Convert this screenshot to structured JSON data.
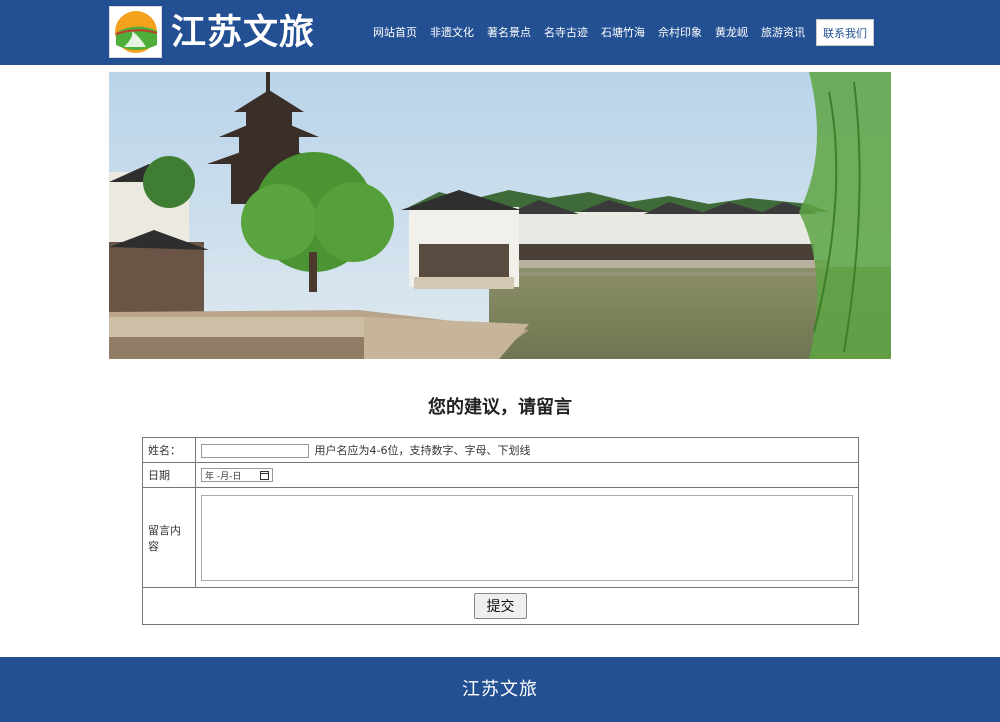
{
  "header": {
    "brand": "江苏文旅",
    "nav": [
      "网站首页",
      "非遗文化",
      "著名景点",
      "名寺古迹",
      "石塘竹海",
      "佘村印象",
      "黄龙岘",
      "旅游资讯"
    ],
    "nav_active": "联系我们"
  },
  "banner": {
    "alt": "江南古镇水乡风景"
  },
  "form": {
    "title": "您的建议，请留言",
    "name_label": "姓名：",
    "name_value": "",
    "name_hint": "用户名应为4-6位，支持数字、字母、下划线",
    "date_label": "日期",
    "date_placeholder": "年 -月-日",
    "message_label": "留言内容",
    "message_value": "",
    "submit_label": "提交"
  },
  "footer": {
    "text": "江苏文旅"
  },
  "colors": {
    "primary": "#235093",
    "background": "#ffffff"
  },
  "icons": {
    "logo": "landscape-logo-icon",
    "date": "calendar-icon"
  }
}
